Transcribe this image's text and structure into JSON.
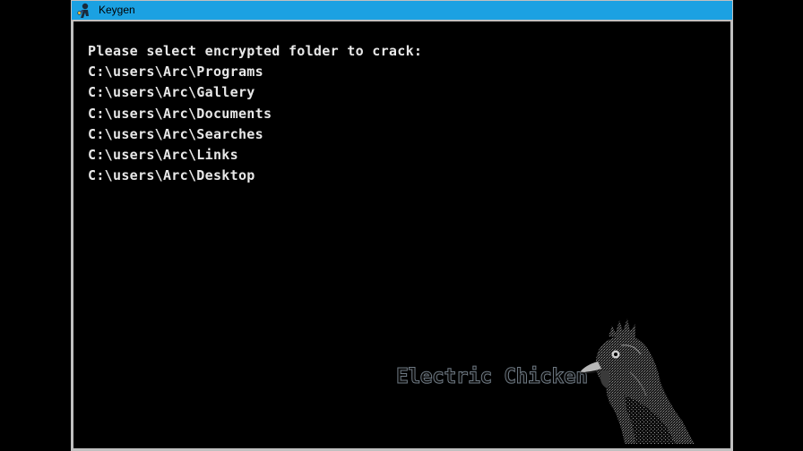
{
  "window": {
    "title": "Keygen",
    "app_icon": "key-person-icon"
  },
  "console": {
    "prompt": "Please select encrypted folder to crack:",
    "folders": [
      "C:\\users\\Arc\\Programs",
      "C:\\users\\Arc\\Gallery",
      "C:\\users\\Arc\\Documents",
      "C:\\users\\Arc\\Searches",
      "C:\\users\\Arc\\Links",
      "C:\\users\\Arc\\Desktop"
    ]
  },
  "branding": {
    "name": "Electric Chicken",
    "logo": "chicken-head-icon"
  },
  "colors": {
    "titlebar": "#1ba1e2",
    "frame": "#c0c0c0",
    "console_bg": "#000000",
    "console_text": "#e8e8e8"
  }
}
